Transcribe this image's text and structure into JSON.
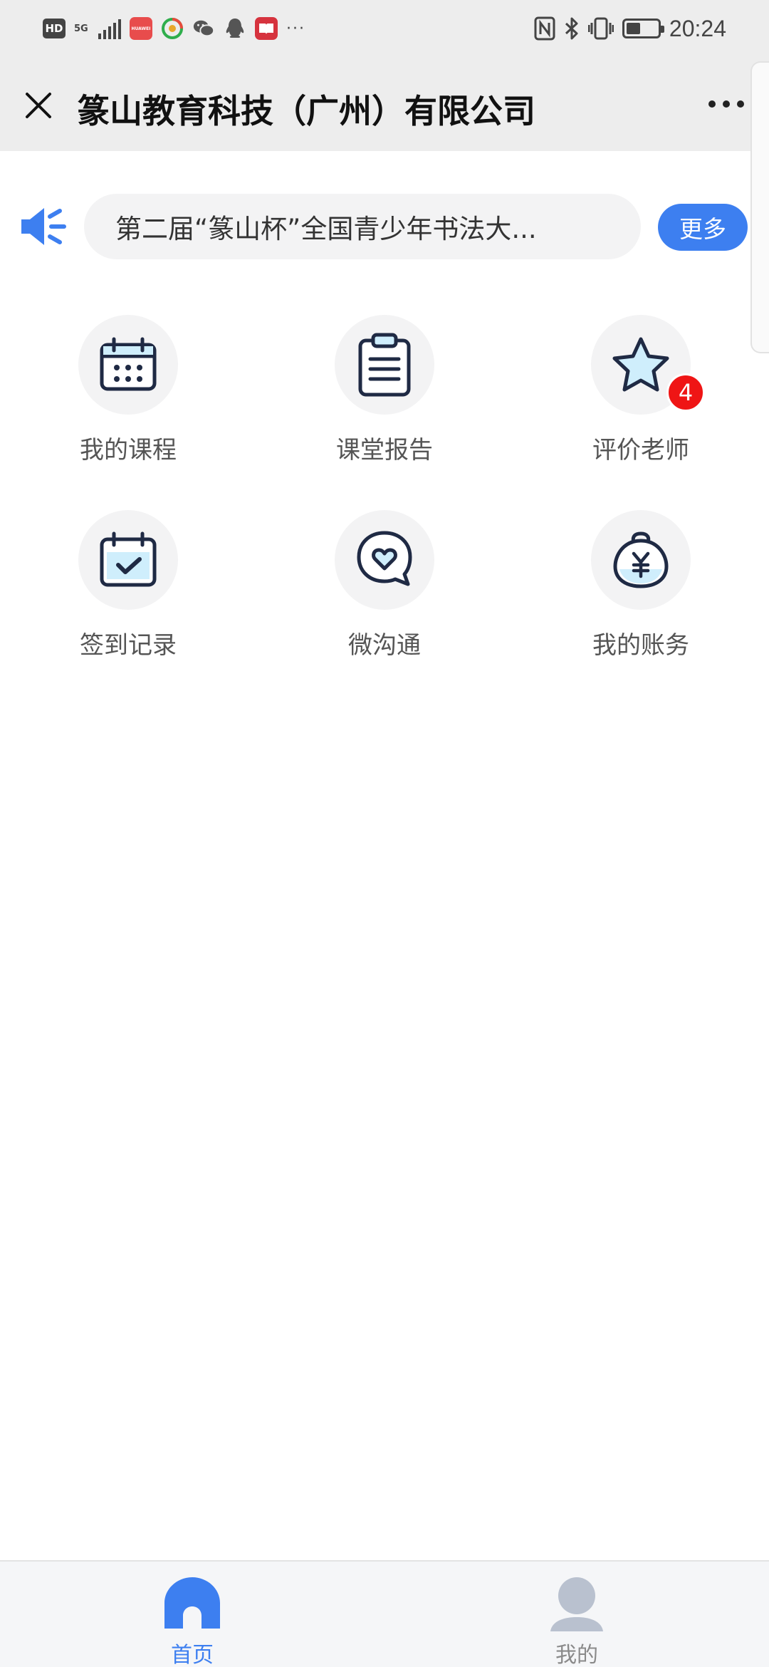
{
  "status_bar": {
    "network_badge": "HD",
    "network_type": "5G",
    "app_label": "HUAWEI",
    "overflow": "···",
    "time": "20:24",
    "battery_level": 0.45,
    "signal_bars": 5
  },
  "header": {
    "title": "篆山教育科技（广州）有限公司",
    "close_icon": "close-icon",
    "more_icon": "more-dots-icon"
  },
  "announcement": {
    "text": "第二届“篆山杯”全国青少年书法大...",
    "more_label": "更多",
    "icon": "speaker-icon",
    "accent_color": "#3d7ff0"
  },
  "grid": {
    "items": [
      {
        "label": "我的课程",
        "icon": "calendar-icon"
      },
      {
        "label": "课堂报告",
        "icon": "clipboard-icon"
      },
      {
        "label": "评价老师",
        "icon": "star-icon",
        "badge": "4"
      },
      {
        "label": "签到记录",
        "icon": "calendar-check-icon"
      },
      {
        "label": "微沟通",
        "icon": "chat-heart-icon"
      },
      {
        "label": "我的账务",
        "icon": "money-bag-icon"
      }
    ]
  },
  "tabbar": {
    "tabs": [
      {
        "label": "首页",
        "icon": "home-icon",
        "active": true
      },
      {
        "label": "我的",
        "icon": "user-icon",
        "active": false
      }
    ],
    "active_color": "#3d7ff0",
    "inactive_color": "#9aa5b8"
  }
}
